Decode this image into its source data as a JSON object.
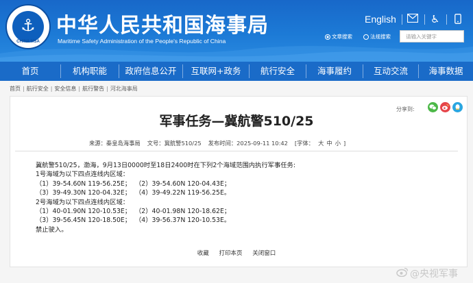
{
  "header": {
    "logo_text": "CHINA MSA",
    "title": "中华人民共和国海事局",
    "subtitle": "Maritime Safety Administration of the People's Republic of China",
    "lang_link": "English",
    "icons": [
      "mail-icon",
      "accessibility-icon",
      "mobile-icon"
    ],
    "search": {
      "options": [
        "文章搜索",
        "法规搜索"
      ],
      "selected": "文章搜索",
      "placeholder": "请输入关键字"
    }
  },
  "nav": {
    "items": [
      "首页",
      "机构职能",
      "政府信息公开",
      "互联网+政务",
      "航行安全",
      "海事履约",
      "互动交流",
      "海事数据"
    ]
  },
  "breadcrumb": [
    "首页",
    "航行安全",
    "安全信息",
    "航行警告",
    "河北海事局"
  ],
  "share": {
    "label": "分享到:",
    "buttons": [
      {
        "name": "wechat-icon",
        "color": "#4cb848",
        "glyph": "✓"
      },
      {
        "name": "weibo-icon",
        "color": "#e6454a",
        "glyph": "◉"
      },
      {
        "name": "qq-icon",
        "color": "#2aa6e0",
        "glyph": "●"
      }
    ]
  },
  "article": {
    "title": "军事任务—冀航警510/25",
    "meta": {
      "source": "来源：秦皇岛海事局",
      "doc_no": "文号：冀航警510/25",
      "publish_time": "发布时间：2025-09-11 10:42",
      "font_label": "[字体：",
      "sizes": [
        "大",
        "中",
        "小"
      ],
      "font_end": "]"
    },
    "lines": [
      "冀航警510/25，渤海，9月13日0000时至18日2400时在下列2个海域范围内执行军事任务:",
      "1号海域为以下四点连线内区域：",
      "（1）39-54.60N 119-56.25E；  （2）39-54.60N 120-04.43E；",
      "（3）39-49.30N 120-04.32E；  （4）39-49.22N 119-56.25E。",
      "2号海域为以下四点连线内区域：",
      "（1）40-01.90N 120-10.53E；  （2）40-01.98N 120-18.62E；",
      "（3）39-56.45N 120-18.50E；  （4）39-56.37N 120-10.53E。",
      "禁止驶入。"
    ],
    "actions": [
      "收藏",
      "打印本页",
      "关闭窗口"
    ]
  },
  "watermark": "@央视军事",
  "colors": {
    "header_bg": "#1c7ad6",
    "nav_bg": "#1a6bc8",
    "page_bg": "#f5f5f5"
  }
}
